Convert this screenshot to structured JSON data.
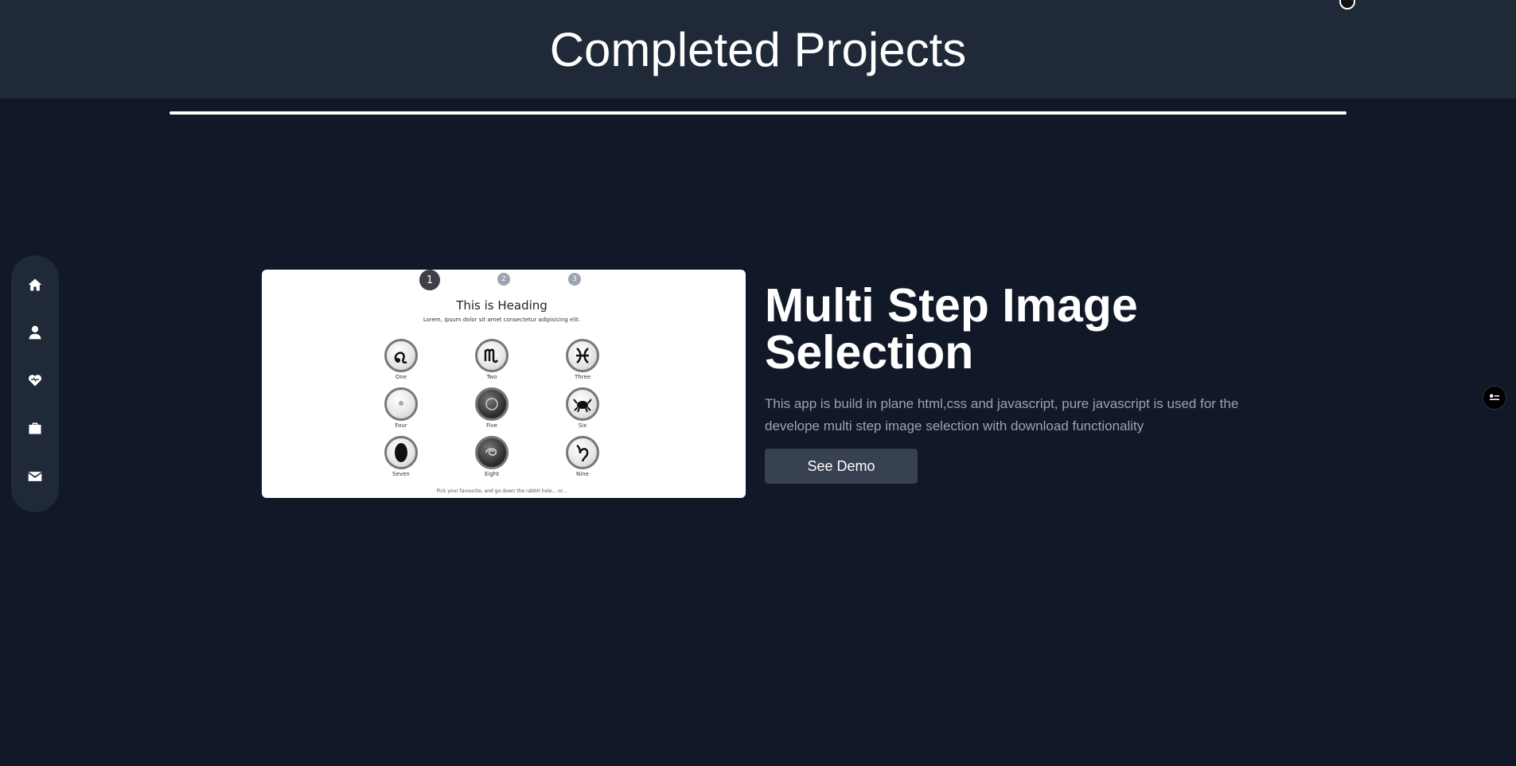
{
  "header": {
    "title": "Completed Projects"
  },
  "sidebar": {
    "items": [
      {
        "name": "home",
        "icon": "home-icon"
      },
      {
        "name": "about",
        "icon": "user-icon"
      },
      {
        "name": "skills",
        "icon": "heart-icon"
      },
      {
        "name": "projects",
        "icon": "briefcase-icon"
      },
      {
        "name": "contact",
        "icon": "envelope-icon"
      }
    ]
  },
  "project": {
    "title": "Multi Step Image Selection",
    "description": "This app is build in plane html,css and javascript, pure javascript is used for the develope multi step image selection with download functionality",
    "button_label": "See Demo",
    "preview": {
      "steps": [
        "1",
        "2",
        "3"
      ],
      "active_step": "1",
      "heading": "This is Heading",
      "subheading": "Lorem, ipsum dolor sit amet consectetur adipisicing elit.",
      "tiles": [
        "One",
        "Two",
        "Three",
        "Four",
        "Five",
        "Six",
        "Seven",
        "Eight",
        "Nine"
      ],
      "footer": "Pick your favourite, and go down the rabbit hole... or..."
    }
  },
  "floating": {
    "settings_icon": "settings-toggle-icon"
  },
  "colors": {
    "background": "#111827",
    "header": "#1f2937",
    "button": "#374151",
    "muted_text": "#9ca3af"
  }
}
